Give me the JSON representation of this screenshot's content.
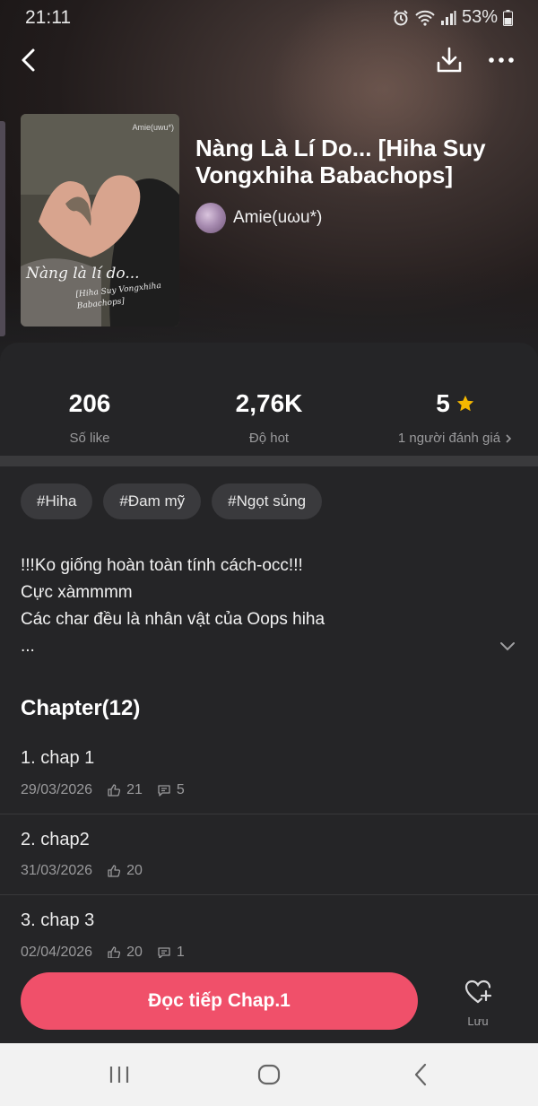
{
  "status_bar": {
    "time": "21:11",
    "battery": "53%",
    "icons": [
      "alarm-icon",
      "wifi-icon",
      "signal-icon",
      "battery-icon"
    ]
  },
  "top_bar": {
    "icons": [
      "back-arrow-icon",
      "download-icon",
      "more-dots-icon"
    ]
  },
  "book": {
    "cover": {
      "author_text": "Amie(uwu*)",
      "title_text": "Nàng là lí do...",
      "subtitle_text": "[Hiha Suy Vongxhiha Babachops]"
    },
    "title": "Nàng Là Lí Do... [Hiha Suy Vongxhiha Babachops]",
    "author": "Amie(uωu*)"
  },
  "stats": [
    {
      "value": "206",
      "label": "Số like"
    },
    {
      "value": "2,76K",
      "label": "Độ hot"
    },
    {
      "value": "5",
      "label": "1 người đánh giá"
    }
  ],
  "tags": [
    "#Hiha",
    "#Đam mỹ",
    "#Ngọt sủng"
  ],
  "description": {
    "lines": [
      "!!!Ko giống hoàn toàn tính cách-occ!!!",
      "Cực xàmmmm",
      "Các char đều là nhân vật của Oops hiha",
      "..."
    ]
  },
  "chapters": {
    "title": "Chapter(12)",
    "items": [
      {
        "name": "1. chap 1",
        "date": "29/03/2026",
        "likes": "21",
        "comments": "5"
      },
      {
        "name": "2. chap2",
        "date": "31/03/2026",
        "likes": "20",
        "comments": ""
      },
      {
        "name": "3. chap 3",
        "date": "02/04/2026",
        "likes": "20",
        "comments": "1"
      }
    ]
  },
  "actions": {
    "read_label": "Đọc tiếp Chap.1",
    "save_label": "Lưu"
  },
  "colors": {
    "accent": "#f0506a",
    "star": "#f5b800",
    "background": "#252527"
  }
}
